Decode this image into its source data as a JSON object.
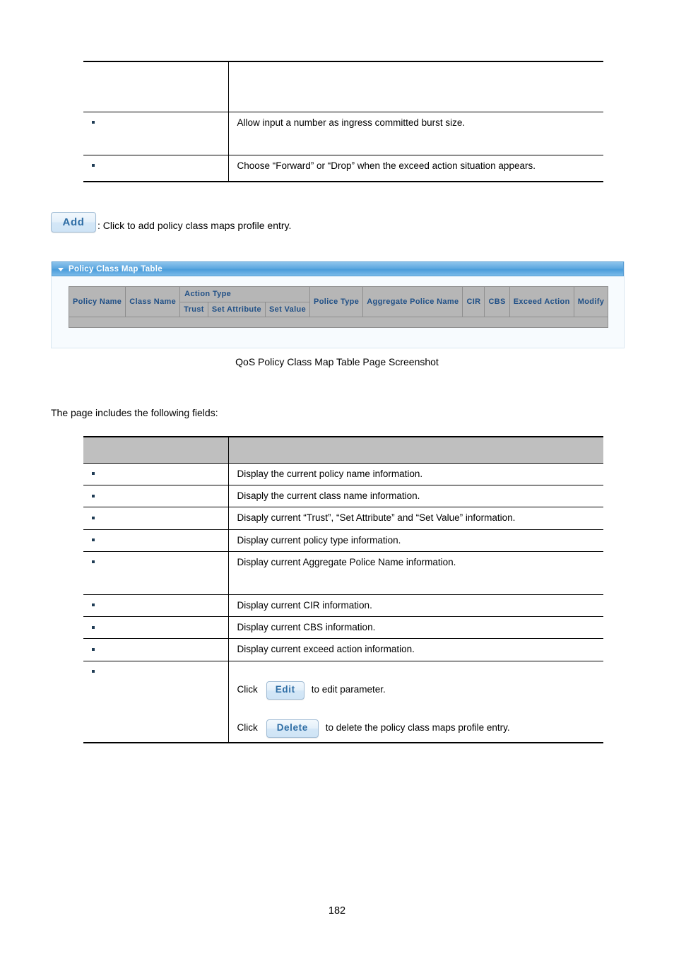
{
  "document": {
    "page_number": "182",
    "figure_caption": "QoS Policy Class Map Table Page Screenshot",
    "intro_line": "The page includes the following fields:"
  },
  "top_table": {
    "header": {
      "name": "",
      "description": ""
    },
    "rows": [
      {
        "name": "",
        "description": "Allow input a number as ingress committed burst size."
      },
      {
        "name": "",
        "description": "Choose “Forward” or “Drop” when the exceed action situation appears."
      }
    ]
  },
  "add_action": {
    "button_label": "Add",
    "description": ": Click to add policy class maps profile entry."
  },
  "widget": {
    "title": "Policy Class Map Table",
    "collapse_icon": "triangle-down-icon",
    "grid": {
      "group_header": "Action Type",
      "columns_before": [
        "Policy Name",
        "Class Name"
      ],
      "action_subcolumns": [
        "Trust",
        "Set Attribute",
        "Set Value"
      ],
      "columns_after": [
        "Police Type",
        "Aggregate Police Name",
        "CIR",
        "CBS",
        "Exceed Action",
        "Modify"
      ],
      "rows": []
    }
  },
  "fields_table": {
    "header": {
      "object": "",
      "description": ""
    },
    "rows": [
      {
        "object": "",
        "description": "Display the current policy name information."
      },
      {
        "object": "",
        "description": "Disaply the current class name information."
      },
      {
        "object": "",
        "description": "Disaply current “Trust”, “Set Attribute” and “Set Value” information."
      },
      {
        "object": "",
        "description": "Display current policy type information."
      },
      {
        "object": "",
        "description": "Display current Aggregate Police Name information."
      },
      {
        "object": "",
        "description": "Display current CIR information."
      },
      {
        "object": "",
        "description": "Display current CBS information."
      },
      {
        "object": "",
        "description": "Display current exceed action information."
      }
    ],
    "modify_row": {
      "object": "",
      "edit_lead": "Click",
      "edit_button_label": "Edit",
      "edit_trail": "to edit parameter.",
      "delete_lead": "Click",
      "delete_button_label": "Delete",
      "delete_trail": "to delete the policy class maps profile entry."
    }
  },
  "colors": {
    "widget_header_blue": "#4a9ddb",
    "grid_header_text": "#1f4f86",
    "grid_header_bg": "#b6b6b6",
    "button_text": "#2f6ea5",
    "doc_header_bg": "#bfbfbf",
    "bullet": "#1f3c55"
  }
}
